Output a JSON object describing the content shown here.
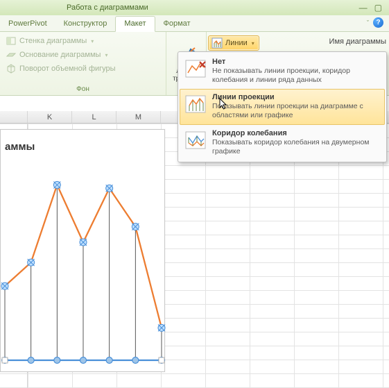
{
  "title_strip": "Работа с диаграммами",
  "tabs": {
    "powerpivot": "PowerPivot",
    "konstruktor": "Конструктор",
    "maket": "Макет",
    "format": "Формат"
  },
  "ribbon": {
    "fon": {
      "wall": "Стенка диаграммы",
      "base": "Основание диаграммы",
      "rotation": "Поворот объемной фигуры",
      "group_label": "Фон"
    },
    "trend": {
      "label_line1": "Линия",
      "label_line2": "тренда"
    },
    "lines_btn": "Линии",
    "name_label": "Имя диаграммы"
  },
  "dropdown": [
    {
      "title": "Нет",
      "desc": "Не показывать линии проекции, коридор колебания и линии ряда данных"
    },
    {
      "title": "Линии проекции",
      "desc": "Показывать линии проекции на диаграмме с областями или графике"
    },
    {
      "title": "Коридор колебания",
      "desc": "Показывать коридор колебания на двумерном графике"
    }
  ],
  "columns": [
    "",
    "K",
    "L",
    "M",
    ""
  ],
  "chart": {
    "title_fragment": "аммы"
  },
  "chart_data": {
    "type": "line",
    "title": "аммы",
    "xlabel": "",
    "ylabel": "",
    "x": [
      0,
      1,
      2,
      3,
      4,
      5,
      6
    ],
    "values": [
      110,
      145,
      260,
      175,
      255,
      198,
      48
    ],
    "ylim": [
      0,
      280
    ],
    "drop_lines": true
  }
}
